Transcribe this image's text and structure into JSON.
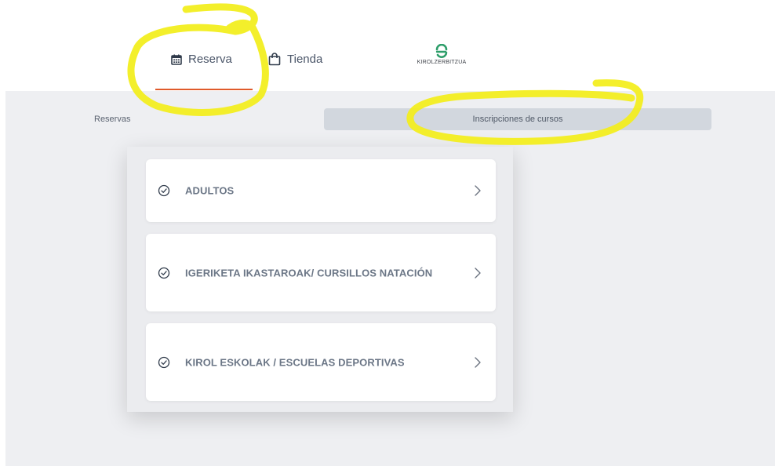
{
  "nav": {
    "tabs": [
      {
        "label": "Reserva",
        "icon": "calendar-icon",
        "active": true
      },
      {
        "label": "Tienda",
        "icon": "shopping-bag-icon",
        "active": false
      }
    ],
    "brand": {
      "name": "KIROLZERBITZUA",
      "logo": "kirolzerbitzua-logo",
      "color": "#2e9e6a"
    },
    "active_underline_color": "#e05a2b"
  },
  "subtabs": [
    {
      "label": "Reservas",
      "active": false
    },
    {
      "label": "Inscripciones de cursos",
      "active": true
    }
  ],
  "courses": [
    {
      "label": "ADULTOS",
      "icon": "check-circle-icon"
    },
    {
      "label": "IGERIKETA IKASTAROAK/ CURSILLOS NATACIÓN",
      "icon": "check-circle-icon"
    },
    {
      "label": "KIROL ESKOLAK / ESCUELAS DEPORTIVAS",
      "icon": "check-circle-icon"
    }
  ],
  "annotation_color": "#f3ee1a"
}
